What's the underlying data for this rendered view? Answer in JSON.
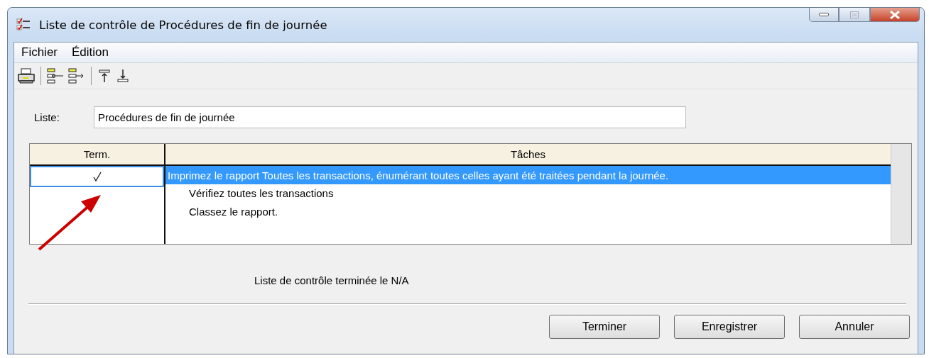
{
  "window": {
    "title": "Liste de contrôle de Procédures de fin de journée"
  },
  "menu": [
    "Fichier",
    "Édition"
  ],
  "list_field": {
    "label": "Liste:",
    "value": "Procédures de fin de journée"
  },
  "table": {
    "columns": [
      "Term.",
      "Tâches"
    ],
    "rows": [
      {
        "checked": true,
        "selected": true,
        "task": "Imprimez le rapport Toutes les transactions, énumérant toutes celles ayant été traitées pendant la journée.",
        "notes": [
          "Vérifiez toutes les transactions",
          "Classez le rapport."
        ]
      }
    ]
  },
  "status": "Liste de contrôle terminée le N/A",
  "buttons": [
    "Terminer",
    "Enregistrer",
    "Annuler"
  ]
}
